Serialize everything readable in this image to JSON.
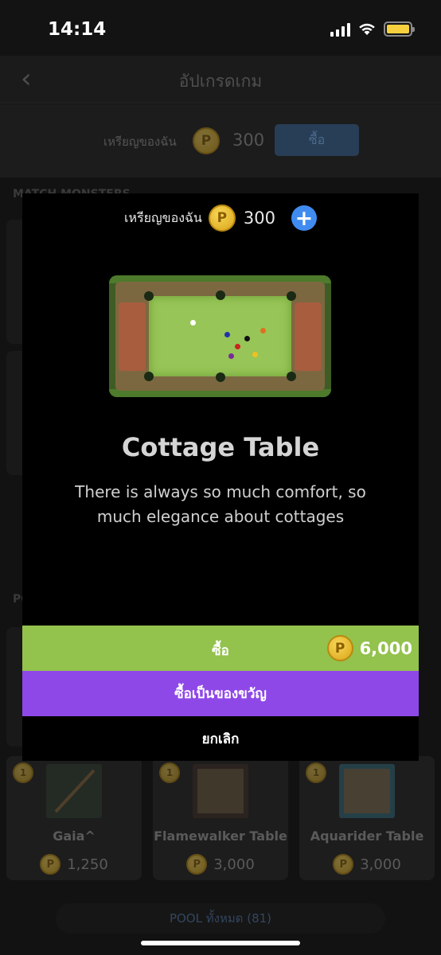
{
  "status_bar": {
    "time": "14:14"
  },
  "header": {
    "title": "อัปเกรดเกม",
    "back_icon": "chevron-left-icon"
  },
  "coin_bar": {
    "label": "เหรียญของฉัน",
    "coins": "300",
    "buy_label": "ซื้อ"
  },
  "coin_glyph": "P",
  "sections": {
    "match_monsters": "MATCH MONSTERS",
    "pool": "PO"
  },
  "items": [
    {
      "name": "Gaia^",
      "price": "1,250",
      "level": "1"
    },
    {
      "name": "Flamewalker Table",
      "price": "3,000",
      "level": "1"
    },
    {
      "name": "Aquarider Table",
      "price": "3,000",
      "level": "1"
    }
  ],
  "pool_all_label": "POOL ทั้งหมด (81)",
  "modal": {
    "coin_label": "เหรียญของฉัน",
    "coins": "300",
    "plus": "+",
    "title": "Cottage Table",
    "description": "There is always so much comfort, so much elegance about cottages",
    "buy_label": "ซื้อ",
    "price": "6,000",
    "gift_label": "ซื้อเป็นของขวัญ",
    "cancel_label": "ยกเลิก"
  },
  "colors": {
    "buy": "#93c24d",
    "gift": "#8f48e8",
    "coin": "#f2c53d",
    "plus": "#3f8bf0"
  }
}
